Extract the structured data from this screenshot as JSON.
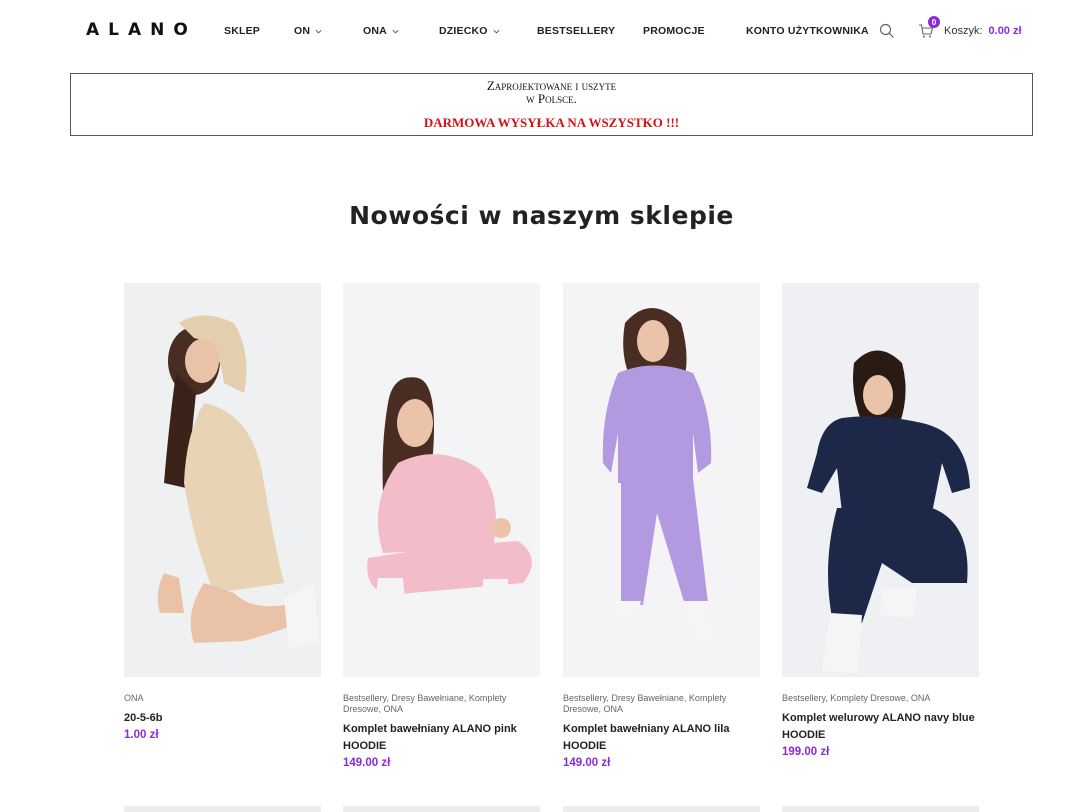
{
  "header": {
    "logo": "ALANO",
    "nav": [
      {
        "label": "SKLEP",
        "dropdown": false
      },
      {
        "label": "ON",
        "dropdown": true
      },
      {
        "label": "ONA",
        "dropdown": true
      },
      {
        "label": "DZIECKO",
        "dropdown": true
      },
      {
        "label": "BESTSELLERY",
        "dropdown": false
      },
      {
        "label": "PROMOCJE",
        "dropdown": false
      },
      {
        "label": "KONTO UŻYTKOWNIKA",
        "dropdown": false
      }
    ],
    "cart": {
      "count": "0",
      "label": "Koszyk:",
      "total": "0.00 zł"
    }
  },
  "banner": {
    "line1": "Zaprojektowane i uszyte",
    "line2": "w Polsce.",
    "promo": "DARMOWA WYSYŁKA NA WSZYSTKO !!!"
  },
  "section_title": "Nowości w naszym sklepie",
  "products": [
    {
      "categories": "ONA",
      "name": "20-5-6b",
      "price": "1.00 zł",
      "outfit_color": "#e8d4b5"
    },
    {
      "categories": "Bestsellery, Dresy Bawełniane, Komplety Dresowe, ONA",
      "name": "Komplet bawełniany ALANO pink HOODIE",
      "price": "149.00 zł",
      "outfit_color": "#f2bcc8"
    },
    {
      "categories": "Bestsellery, Dresy Bawełniane, Komplety Dresowe, ONA",
      "name": "Komplet bawełniany ALANO lila HOODIE",
      "price": "149.00 zł",
      "outfit_color": "#b39ae0"
    },
    {
      "categories": "Bestsellery, Komplety Dresowe, ONA",
      "name": "Komplet welurowy ALANO navy blue HOODIE",
      "price": "199.00 zł",
      "outfit_color": "#1d2748"
    }
  ],
  "colors": {
    "accent": "#8a2bd6",
    "promo": "#d01313"
  }
}
